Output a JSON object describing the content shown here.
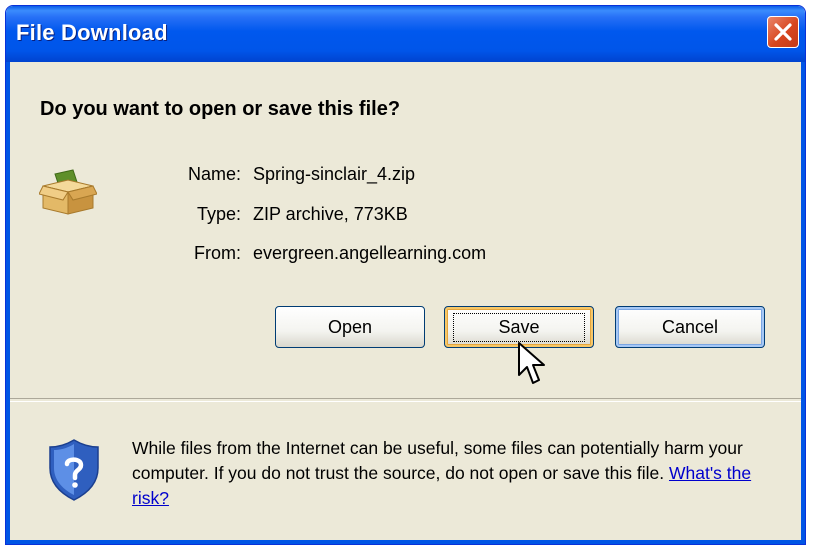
{
  "window": {
    "title": "File Download",
    "close_icon": "close-icon"
  },
  "dialog": {
    "question": "Do you want to open or save this file?",
    "file_icon": "package-box-icon",
    "fields": {
      "name_label": "Name:",
      "name_value": "Spring-sinclair_4.zip",
      "type_label": "Type:",
      "type_value": "ZIP archive, 773KB",
      "from_label": "From:",
      "from_value": "evergreen.angellearning.com"
    },
    "buttons": {
      "open": "Open",
      "save": "Save",
      "cancel": "Cancel"
    },
    "warning": {
      "text": "While files from the Internet can be useful, some files can potentially harm your computer. If you do not trust the source, do not open or save this file.",
      "link": "What's the risk?",
      "icon": "security-shield-question-icon"
    }
  },
  "colors": {
    "titlebar": "#0055e9",
    "dialog_bg": "#ece9d8",
    "close_button": "#d8461f",
    "link": "#0000cc"
  }
}
